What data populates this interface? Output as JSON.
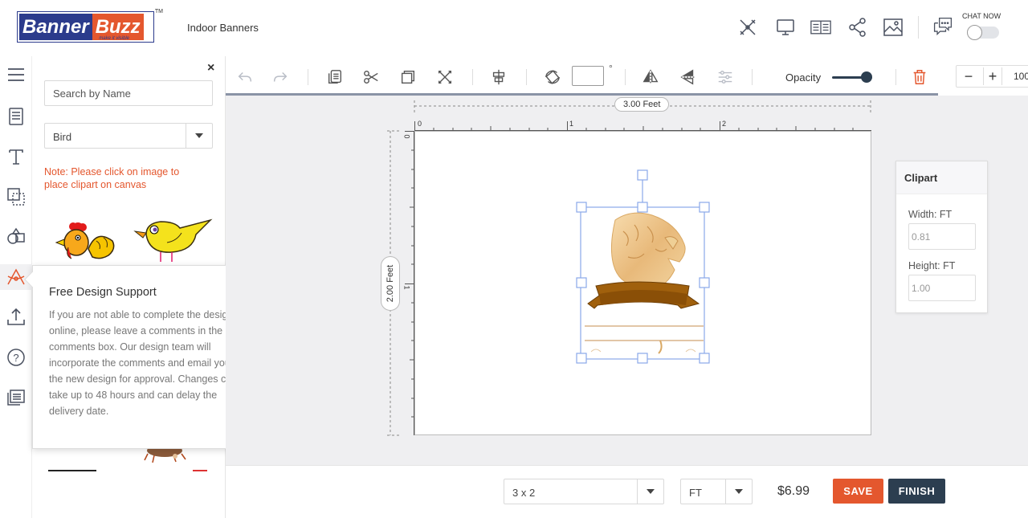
{
  "header": {
    "logo_part1": "Banner",
    "logo_part2": "Buzz",
    "logo_tagline": "make it visible",
    "logo_tm": "TM",
    "product_title": "Indoor Banners",
    "chat_label": "CHAT NOW",
    "icons": [
      "tools-icon",
      "desktop-preview-icon",
      "guide-book-icon",
      "share-icon",
      "image-icon",
      "chat-icon"
    ]
  },
  "rail": {
    "icons": [
      "menu-icon",
      "templates-icon",
      "text-icon",
      "background-icon",
      "shapes-icon",
      "clipart-icon",
      "upload-icon",
      "help-icon",
      "comments-icon"
    ]
  },
  "panel": {
    "search_placeholder": "Search by Name",
    "category_value": "Bird",
    "note": "Note: Please click on image to place clipart on canvas"
  },
  "support_popup": {
    "title": "Free Design Support",
    "body": "If you are not able to complete the design online, please leave a comments in the comments box. Our design team will incorporate the comments and email you the new design for approval. Changes can take up to 48 hours and can delay the delivery date."
  },
  "toolbar": {
    "degree_symbol": "°",
    "opacity_label": "Opacity",
    "zoom_value": "100",
    "zoom_minus": "−",
    "zoom_plus": "+",
    "opacity_level": 0.85
  },
  "canvas": {
    "width_label": "3.00 Feet",
    "height_label": "2.00 Feet",
    "ruler_h_labels": [
      "0",
      "1",
      "2"
    ],
    "ruler_v_labels": [
      "0",
      "1"
    ]
  },
  "clipart_props": {
    "title": "Clipart",
    "width_label": "Width: FT",
    "width_value": "0.81",
    "height_label": "Height: FT",
    "height_value": "1.00"
  },
  "footer": {
    "size_value": "3 x 2",
    "unit_value": "FT",
    "price": "$6.99",
    "save_label": "SAVE",
    "finish_label": "FINISH"
  },
  "colors": {
    "brand_blue": "#2b3b8c",
    "brand_orange": "#e4572e",
    "dark_button": "#2c3e50"
  }
}
